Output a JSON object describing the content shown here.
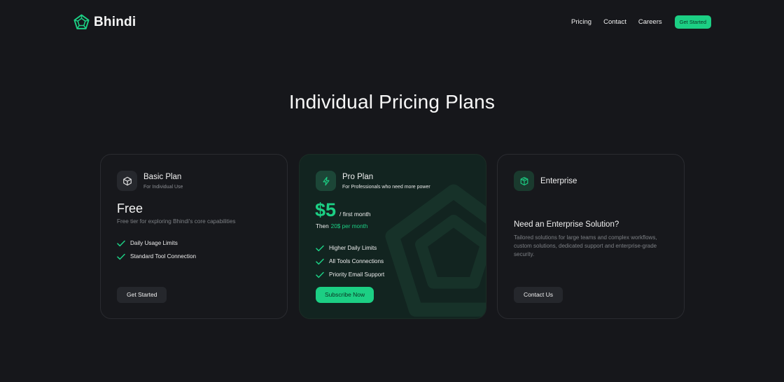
{
  "brand": {
    "name": "Bhindi"
  },
  "nav": {
    "links": [
      "Pricing",
      "Contact",
      "Careers"
    ],
    "cta": "Get Started"
  },
  "page": {
    "title": "Individual Pricing Plans"
  },
  "colors": {
    "background": "#16171b",
    "accent": "#1ccf84",
    "pro_card": "#122420",
    "card_border": "#2a2b30"
  },
  "plans": {
    "basic": {
      "icon": "cube-icon",
      "name": "Basic Plan",
      "subtitle": "For Individual Use",
      "price": "Free",
      "description": "Free tier for exploring Bhindi's core capabilities",
      "features": [
        "Daily Usage Limits",
        "Standard Tool Connection"
      ],
      "button": "Get Started"
    },
    "pro": {
      "icon": "bolt-icon",
      "name": "Pro Plan",
      "subtitle": "For Professionals who need more power",
      "price": "$5",
      "period": "/ first month",
      "then_prefix": "Then",
      "then_price": "20$ per month",
      "features": [
        "Higher Daily Limits",
        "All Tools Connections",
        "Priority Email Support"
      ],
      "button": "Subscribe Now"
    },
    "enterprise": {
      "icon": "box-stack-icon",
      "name": "Enterprise",
      "heading": "Need an Enterprise Solution?",
      "description": "Tailored solutions for large teams and complex workflows, custom solutions, dedicated support and enterprise-grade security.",
      "button": "Contact Us"
    }
  }
}
